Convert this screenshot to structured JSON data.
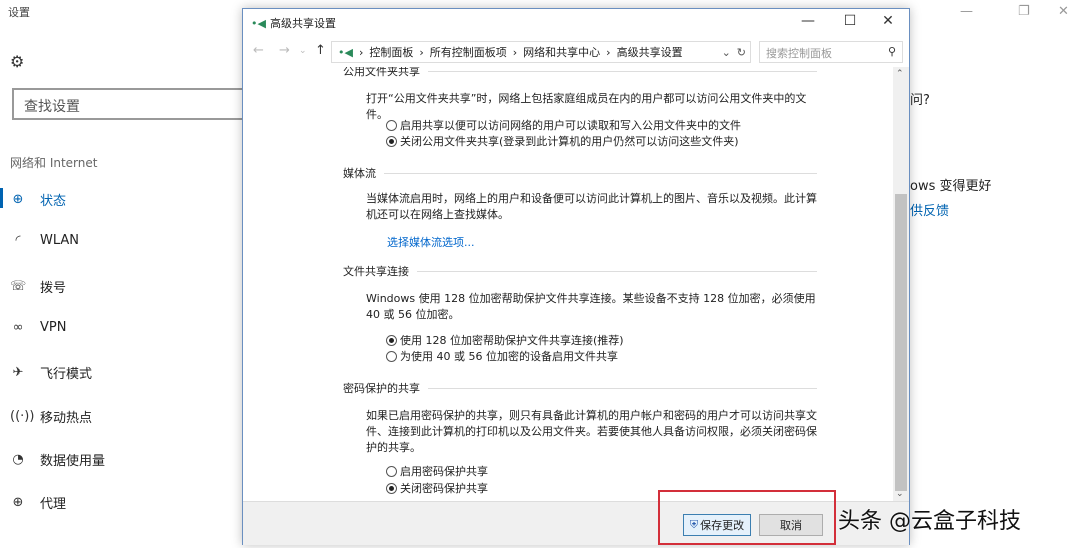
{
  "settings": {
    "title": "设置",
    "search_placeholder": "查找设置",
    "category": "网络和 Internet",
    "nav": [
      {
        "icon": "globe-status-icon",
        "glyph": "⊕",
        "label": "状态"
      },
      {
        "icon": "wifi-icon",
        "glyph": "◜",
        "label": "WLAN"
      },
      {
        "icon": "dialup-icon",
        "glyph": "☏",
        "label": "拨号"
      },
      {
        "icon": "vpn-icon",
        "glyph": "∞",
        "label": "VPN"
      },
      {
        "icon": "airplane-icon",
        "glyph": "✈",
        "label": "飞行模式"
      },
      {
        "icon": "hotspot-icon",
        "glyph": "((·))",
        "label": "移动热点"
      },
      {
        "icon": "data-usage-icon",
        "glyph": "◔",
        "label": "数据使用量"
      },
      {
        "icon": "proxy-icon",
        "glyph": "⊕",
        "label": "代理"
      }
    ],
    "right_question": "问?",
    "right_improve": "ows 变得更好",
    "right_feedback": "供反馈"
  },
  "dialog": {
    "title": "高级共享设置",
    "breadcrumbs": [
      "控制面板",
      "所有控制面板项",
      "网络和共享中心",
      "高级共享设置"
    ],
    "search_placeholder": "搜索控制面板",
    "sections": {
      "public": {
        "title": "公用文件夹共享",
        "desc": "打开“公用文件夹共享”时，网络上包括家庭组成员在内的用户都可以访问公用文件夹中的文件。",
        "options": [
          "启用共享以便可以访问网络的用户可以读取和写入公用文件夹中的文件",
          "关闭公用文件夹共享(登录到此计算机的用户仍然可以访问这些文件夹)"
        ]
      },
      "media": {
        "title": "媒体流",
        "desc": "当媒体流启用时，网络上的用户和设备便可以访问此计算机上的图片、音乐以及视频。此计算机还可以在网络上查找媒体。",
        "link": "选择媒体流选项..."
      },
      "file": {
        "title": "文件共享连接",
        "desc": "Windows 使用 128 位加密帮助保护文件共享连接。某些设备不支持 128 位加密，必须使用 40 或 56 位加密。",
        "options": [
          "使用 128 位加密帮助保护文件共享连接(推荐)",
          "为使用 40 或 56 位加密的设备启用文件共享"
        ]
      },
      "password": {
        "title": "密码保护的共享",
        "desc": "如果已启用密码保护的共享，则只有具备此计算机的用户帐户和密码的用户才可以访问共享文件、连接到此计算机的打印机以及公用文件夹。若要使其他人具备访问权限，必须关闭密码保护的共享。",
        "options": [
          "启用密码保护共享",
          "关闭密码保护共享"
        ]
      }
    },
    "save": "保存更改",
    "cancel": "取消"
  },
  "watermark": "头条 @云盒子科技"
}
